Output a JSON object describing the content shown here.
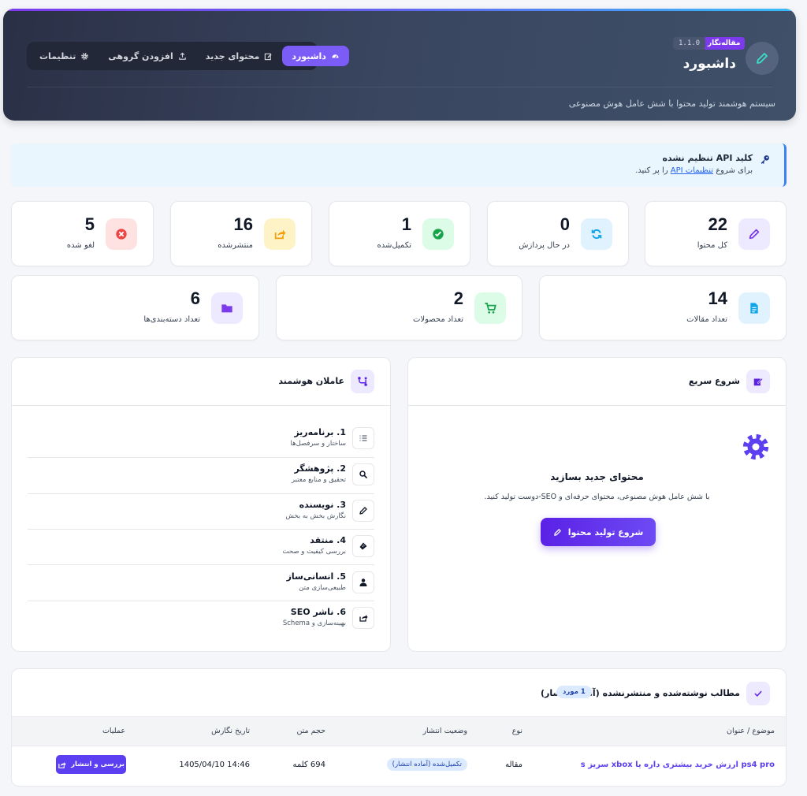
{
  "header": {
    "title": "داشبورد",
    "role_badge": "مقاله‌نگار",
    "version": "1.1.0",
    "subtitle": "سیستم هوشمند تولید محتوا با شش عامل هوش مصنوعی",
    "nav": [
      {
        "label": "داشبورد",
        "icon": "gauge-icon",
        "active": true
      },
      {
        "label": "محتوای جدید",
        "icon": "edit-icon"
      },
      {
        "label": "افزودن گروهی",
        "icon": "upload-icon"
      },
      {
        "label": "تنظیمات",
        "icon": "gear-icon"
      }
    ]
  },
  "alert": {
    "title": "کلید API تنظیم نشده",
    "text_before": "برای شروع ",
    "link": "تنظیمات API",
    "text_after": " را پر کنید."
  },
  "stats": [
    {
      "value": "22",
      "label": "کل محتوا",
      "icon": "pencil-icon",
      "color": "#7c3aed",
      "bg": "#ede9fe"
    },
    {
      "value": "0",
      "label": "در حال پردازش",
      "icon": "sync-icon",
      "color": "#0ea5e9",
      "bg": "#e0f2fe"
    },
    {
      "value": "1",
      "label": "تکمیل‌شده",
      "icon": "check-circle-icon",
      "color": "#16a34a",
      "bg": "#dcfce7"
    },
    {
      "value": "16",
      "label": "منتشرشده",
      "icon": "share-icon",
      "color": "#f59e0b",
      "bg": "#fef3c7"
    },
    {
      "value": "5",
      "label": "لغو شده",
      "icon": "cancel-icon",
      "color": "#ef4444",
      "bg": "#fee2e2"
    },
    {
      "value": "14",
      "label": "تعداد مقالات",
      "icon": "document-icon",
      "color": "#0ea5e9",
      "bg": "#e0f2fe"
    },
    {
      "value": "2",
      "label": "تعداد محصولات",
      "icon": "cart-icon",
      "color": "#16a34a",
      "bg": "#dcfce7"
    },
    {
      "value": "6",
      "label": "تعداد دسته‌بندی‌ها",
      "icon": "folder-icon",
      "color": "#7c3aed",
      "bg": "#ede9fe"
    }
  ],
  "quick_start": {
    "title": "شروع سریع",
    "heading": "محتوای جدید بسازید",
    "text": "با شش عامل هوش مصنوعی، محتوای حرفه‌ای و SEO-دوست تولید کنید.",
    "button": "شروع تولید محتوا"
  },
  "agents": {
    "title": "عاملان هوشمند",
    "items": [
      {
        "name": "1. برنامه‌ریز",
        "desc": "ساختار و سرفصل‌ها",
        "icon": "list-icon"
      },
      {
        "name": "2. پژوهشگر",
        "desc": "تحقیق و منابع معتبر",
        "icon": "search-icon"
      },
      {
        "name": "3. نویسنده",
        "desc": "نگارش بخش به بخش",
        "icon": "pen-icon"
      },
      {
        "name": "4. منتقد",
        "desc": "بررسی کیفیت و صحت",
        "icon": "stamp-icon"
      },
      {
        "name": "5. انسانی‌ساز",
        "desc": "طبیعی‌سازی متن",
        "icon": "user-icon"
      },
      {
        "name": "6. ناشر SEO",
        "desc": "بهینه‌سازی و Schema",
        "icon": "share-icon"
      }
    ]
  },
  "table": {
    "title": "مطالب نوشته‌شده و منتشرنشده (آماده انتشار)",
    "count": "1 مورد",
    "columns": [
      "موضوع / عنوان",
      "نوع",
      "وضعیت انتشار",
      "حجم متن",
      "تاریخ نگارش",
      "عملیات"
    ],
    "rows": [
      {
        "title": "ps4 pro ارزش خرید بیشتری داره یا xbox سریز s",
        "type": "مقاله",
        "status": "تکمیل‌شده (آماده انتشار)",
        "size": "694 کلمه",
        "date": "14:46 1405/04/10",
        "action": "بررسی و انتشار"
      }
    ]
  }
}
